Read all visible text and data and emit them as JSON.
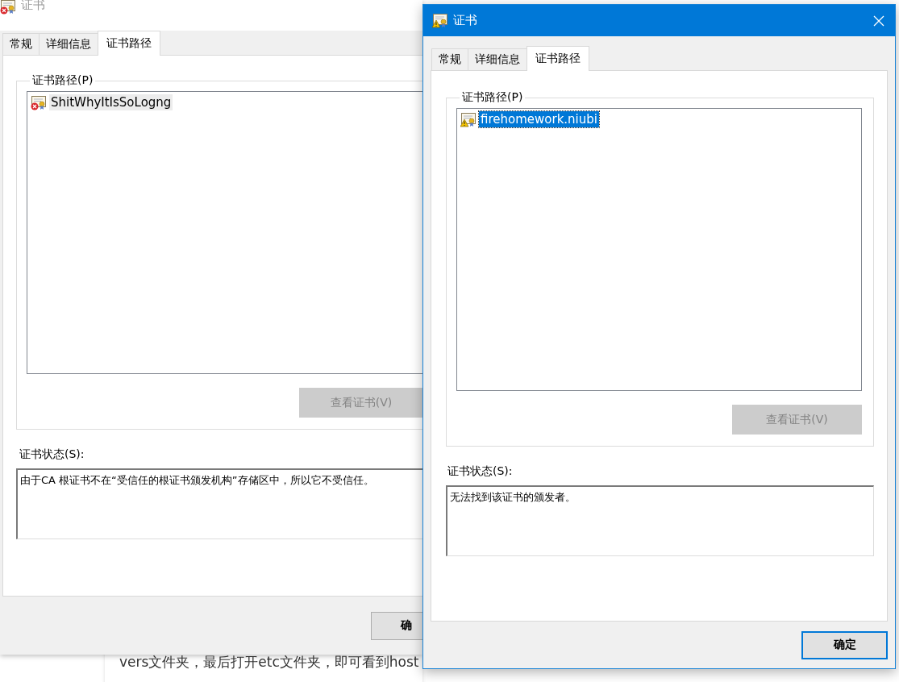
{
  "background_page": {
    "text": "vers文件夹，最后打开etc文件夹，即可看到host"
  },
  "windows": [
    {
      "title": "证书",
      "active": false,
      "kind": "error",
      "tabs": [
        {
          "label": "常规",
          "selected": false
        },
        {
          "label": "详细信息",
          "selected": false
        },
        {
          "label": "证书路径",
          "selected": true
        }
      ],
      "path_group": {
        "label": "证书路径(P)",
        "items": [
          {
            "label": "ShitWhyItIsSoLogng",
            "kind": "error",
            "selected": true
          }
        ]
      },
      "view_button": {
        "label": "查看证书(V)",
        "disabled": true
      },
      "status_label": "证书状态(S):",
      "status_text": "由于CA 根证书不在“受信任的根证书颁发机构”存储区中，所以它不受信任。",
      "ok_button": {
        "label": "确",
        "default": false
      }
    },
    {
      "title": "证书",
      "active": true,
      "kind": "warning",
      "tabs": [
        {
          "label": "常规",
          "selected": false
        },
        {
          "label": "详细信息",
          "selected": false
        },
        {
          "label": "证书路径",
          "selected": true
        }
      ],
      "path_group": {
        "label": "证书路径(P)",
        "items": [
          {
            "label": "firehomework.niubi",
            "kind": "warning",
            "selected": true
          }
        ]
      },
      "view_button": {
        "label": "查看证书(V)",
        "disabled": true
      },
      "status_label": "证书状态(S):",
      "status_text": "无法找到该证书的颁发者。",
      "ok_button": {
        "label": "确定",
        "default": true
      }
    }
  ]
}
